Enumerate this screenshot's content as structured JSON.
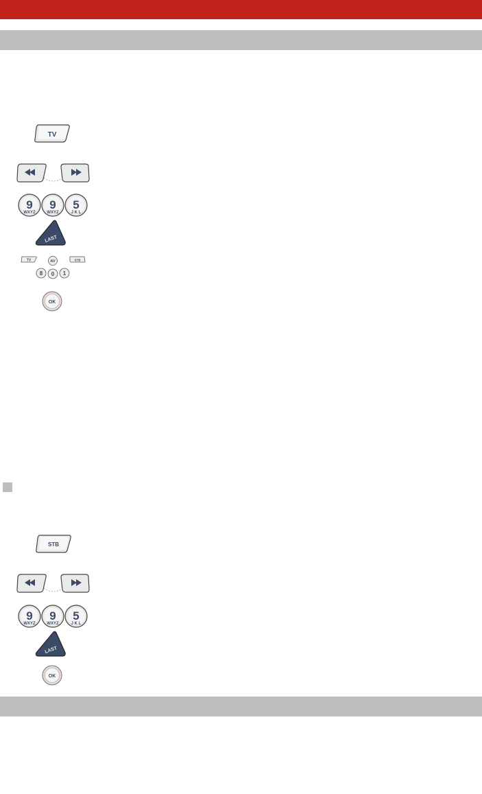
{
  "colors": {
    "header_red": "#c0221b",
    "bar_gray": "#bdbdbd",
    "key_text": "#3b4a66",
    "last_key": "#3b4a66"
  },
  "section1": {
    "tv_key": "TV",
    "prev_icon": "rewind-icon",
    "next_icon": "fast-forward-icon",
    "digits": [
      {
        "digit": "9",
        "letters": "WXYZ"
      },
      {
        "digit": "9",
        "letters": "WXYZ"
      },
      {
        "digit": "5",
        "letters": "J K L"
      }
    ],
    "last_key": "LAST",
    "mini_keys": {
      "tv": "TV",
      "av": "AV",
      "stb": "STB",
      "eight": "8",
      "zero": "0",
      "one": "1"
    },
    "ok_key": "OK"
  },
  "section2": {
    "stb_key": "STB",
    "digits": [
      {
        "digit": "9",
        "letters": "WXYZ"
      },
      {
        "digit": "9",
        "letters": "WXYZ"
      },
      {
        "digit": "5",
        "letters": "J K L"
      }
    ],
    "last_key": "LAST",
    "ok_key": "OK"
  }
}
